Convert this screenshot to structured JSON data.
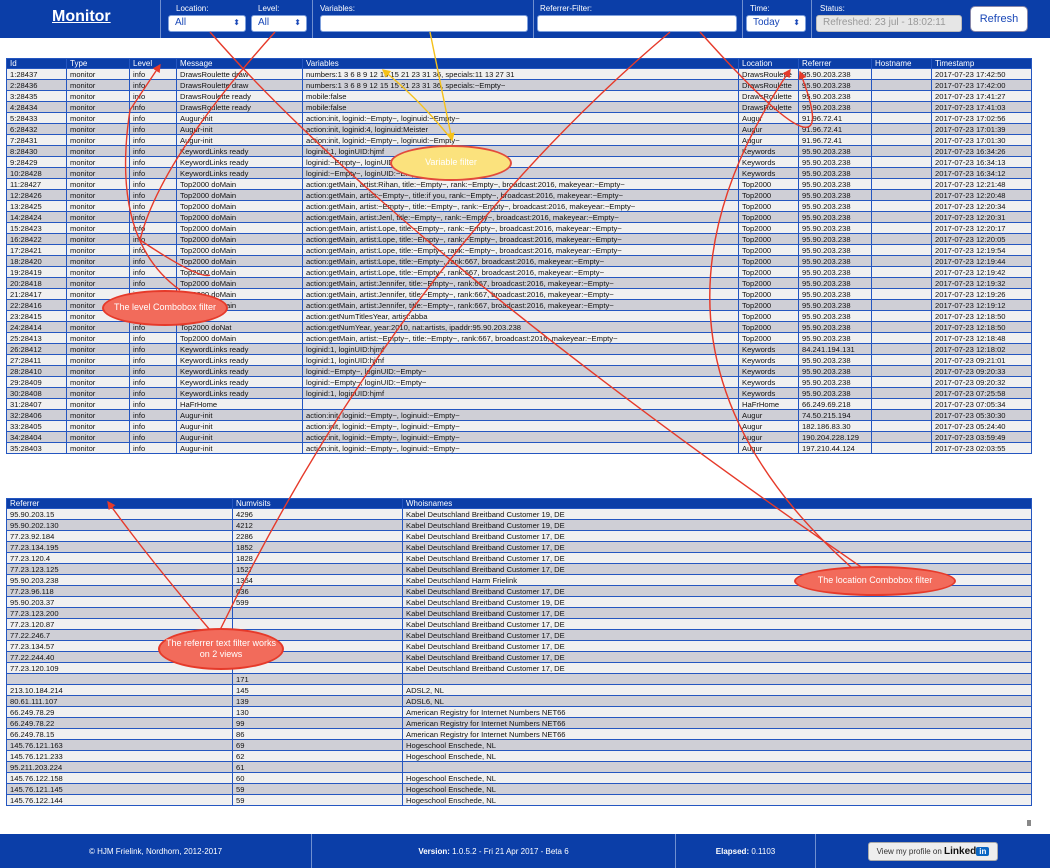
{
  "header": {
    "logo": "Monitor",
    "location": {
      "label": "Location:",
      "value": "All"
    },
    "level": {
      "label": "Level:",
      "value": "All"
    },
    "variables": {
      "label": "Variables:",
      "value": ""
    },
    "referrer_filter": {
      "label": "Referrer-Filter:",
      "value": ""
    },
    "time": {
      "label": "Time:",
      "value": "Today"
    },
    "status": {
      "label": "Status:",
      "value": "Refreshed: 23 jul - 18:02:11"
    },
    "refresh_label": "Refresh"
  },
  "log_table": {
    "columns": [
      "Id",
      "Type",
      "Level",
      "Message",
      "Variables",
      "Location",
      "Referrer",
      "Hostname",
      "Timestamp"
    ],
    "rows": [
      [
        "1:28437",
        "monitor",
        "info",
        "DrawsRoulette draw",
        "numbers:1 3 6 8 9 12 15 15 21 23 31 36, specials:11 13 27 31",
        "DrawsRoulette",
        "95.90.203.238",
        "",
        "2017-07-23 17:42:50"
      ],
      [
        "2:28436",
        "monitor",
        "info",
        "DrawsRoulette draw",
        "numbers:1 3 6 8 9 12 15 15 21 23 31 36, specials:~Empty~",
        "DrawsRoulette",
        "95.90.203.238",
        "",
        "2017-07-23 17:42:00"
      ],
      [
        "3:28435",
        "monitor",
        "info",
        "DrawsRoulette ready",
        "mobile:false",
        "DrawsRoulette",
        "95.90.203.238",
        "",
        "2017-07-23 17:41:27"
      ],
      [
        "4:28434",
        "monitor",
        "info",
        "DrawsRoulette ready",
        "mobile:false",
        "DrawsRoulette",
        "95.90.203.238",
        "",
        "2017-07-23 17:41:03"
      ],
      [
        "5:28433",
        "monitor",
        "info",
        "Augur-init",
        "action:init, loginid:~Empty~, loginuid:~Empty~",
        "Augur",
        "91.96.72.41",
        "",
        "2017-07-23 17:02:56"
      ],
      [
        "6:28432",
        "monitor",
        "info",
        "Augur-init",
        "action:init, loginid:4, loginuid:Meister",
        "Augur",
        "91.96.72.41",
        "",
        "2017-07-23 17:01:39"
      ],
      [
        "7:28431",
        "monitor",
        "info",
        "Augur-init",
        "action:init, loginid:~Empty~, loginuid:~Empty~",
        "Augur",
        "91.96.72.41",
        "",
        "2017-07-23 17:01:30"
      ],
      [
        "8:28430",
        "monitor",
        "info",
        "KeywordLinks ready",
        "loginid:1, loginUID:hjmf",
        "Keywords",
        "95.90.203.238",
        "",
        "2017-07-23 16:34:26"
      ],
      [
        "9:28429",
        "monitor",
        "info",
        "KeywordLinks ready",
        "loginid:~Empty~, loginUID:~Empty~",
        "Keywords",
        "95.90.203.238",
        "",
        "2017-07-23 16:34:13"
      ],
      [
        "10:28428",
        "monitor",
        "info",
        "KeywordLinks ready",
        "loginid:~Empty~, loginUID:~Empty~",
        "Keywords",
        "95.90.203.238",
        "",
        "2017-07-23 16:34:12"
      ],
      [
        "11:28427",
        "monitor",
        "info",
        "Top2000 doMain",
        "action:getMain, artist:Rihan, title:~Empty~, rank:~Empty~, broadcast:2016, makeyear:~Empty~",
        "Top2000",
        "95.90.203.238",
        "",
        "2017-07-23 12:21:48"
      ],
      [
        "12:28426",
        "monitor",
        "info",
        "Top2000 doMain",
        "action:getMain, artist:~Empty~, title:if you, rank:~Empty~, broadcast:2016, makeyear:~Empty~",
        "Top2000",
        "95.90.203.238",
        "",
        "2017-07-23 12:20:48"
      ],
      [
        "13:28425",
        "monitor",
        "info",
        "Top2000 doMain",
        "action:getMain, artist:~Empty~, title:~Empty~, rank:~Empty~, broadcast:2016, makeyear:~Empty~",
        "Top2000",
        "95.90.203.238",
        "",
        "2017-07-23 12:20:34"
      ],
      [
        "14:28424",
        "monitor",
        "info",
        "Top2000 doMain",
        "action:getMain, artist:Jenl, title:~Empty~, rank:~Empty~, broadcast:2016, makeyear:~Empty~",
        "Top2000",
        "95.90.203.238",
        "",
        "2017-07-23 12:20:31"
      ],
      [
        "15:28423",
        "monitor",
        "info",
        "Top2000 doMain",
        "action:getMain, artist:Lope, title:~Empty~, rank:~Empty~, broadcast:2016, makeyear:~Empty~",
        "Top2000",
        "95.90.203.238",
        "",
        "2017-07-23 12:20:17"
      ],
      [
        "16:28422",
        "monitor",
        "info",
        "Top2000 doMain",
        "action:getMain, artist:Lope, title:~Empty~, rank:~Empty~, broadcast:2016, makeyear:~Empty~",
        "Top2000",
        "95.90.203.238",
        "",
        "2017-07-23 12:20:05"
      ],
      [
        "17:28421",
        "monitor",
        "info",
        "Top2000 doMain",
        "action:getMain, artist:Lope, title:~Empty~, rank:~Empty~, broadcast:2016, makeyear:~Empty~",
        "Top2000",
        "95.90.203.238",
        "",
        "2017-07-23 12:19:54"
      ],
      [
        "18:28420",
        "monitor",
        "info",
        "Top2000 doMain",
        "action:getMain, artist:Lope, title:~Empty~, rank:667, broadcast:2016, makeyear:~Empty~",
        "Top2000",
        "95.90.203.238",
        "",
        "2017-07-23 12:19:44"
      ],
      [
        "19:28419",
        "monitor",
        "info",
        "Top2000 doMain",
        "action:getMain, artist:Lope, title:~Empty~, rank:667, broadcast:2016, makeyear:~Empty~",
        "Top2000",
        "95.90.203.238",
        "",
        "2017-07-23 12:19:42"
      ],
      [
        "20:28418",
        "monitor",
        "info",
        "Top2000 doMain",
        "action:getMain, artist:Jennifer, title:~Empty~, rank:667, broadcast:2016, makeyear:~Empty~",
        "Top2000",
        "95.90.203.238",
        "",
        "2017-07-23 12:19:32"
      ],
      [
        "21:28417",
        "monitor",
        "info",
        "Top2000 doMain",
        "action:getMain, artist:Jennifer, title:~Empty~, rank:667, broadcast:2016, makeyear:~Empty~",
        "Top2000",
        "95.90.203.238",
        "",
        "2017-07-23 12:19:26"
      ],
      [
        "22:28416",
        "monitor",
        "info",
        "Top2000 doMain",
        "action:getMain, artist:Jennifer, title:~Empty~, rank:667, broadcast:2016, makeyear:~Empty~",
        "Top2000",
        "95.90.203.238",
        "",
        "2017-07-23 12:19:12"
      ],
      [
        "23:28415",
        "monitor",
        "info",
        "",
        "action:getNumTitlesYear, artist:abba",
        "Top2000",
        "95.90.203.238",
        "",
        "2017-07-23 12:18:50"
      ],
      [
        "24:28414",
        "monitor",
        "info",
        "Top2000 doNat",
        "action:getNumYear, year:2010, nat:artists, ipaddr:95.90.203.238",
        "Top2000",
        "95.90.203.238",
        "",
        "2017-07-23 12:18:50"
      ],
      [
        "25:28413",
        "monitor",
        "info",
        "Top2000 doMain",
        "action:getMain, artist:~Empty~, title:~Empty~, rank:667, broadcast:2016, makeyear:~Empty~",
        "Top2000",
        "95.90.203.238",
        "",
        "2017-07-23 12:18:48"
      ],
      [
        "26:28412",
        "monitor",
        "info",
        "KeywordLinks ready",
        "loginid:1, loginUID:hjmf",
        "Keywords",
        "84.241.194.131",
        "",
        "2017-07-23 12:18:02"
      ],
      [
        "27:28411",
        "monitor",
        "info",
        "KeywordLinks ready",
        "loginid:1, loginUID:hjmf",
        "Keywords",
        "95.90.203.238",
        "",
        "2017-07-23 09:21:01"
      ],
      [
        "28:28410",
        "monitor",
        "info",
        "KeywordLinks ready",
        "loginid:~Empty~, loginUID:~Empty~",
        "Keywords",
        "95.90.203.238",
        "",
        "2017-07-23 09:20:33"
      ],
      [
        "29:28409",
        "monitor",
        "info",
        "KeywordLinks ready",
        "loginid:~Empty~, loginUID:~Empty~",
        "Keywords",
        "95.90.203.238",
        "",
        "2017-07-23 09:20:32"
      ],
      [
        "30:28408",
        "monitor",
        "info",
        "KeywordLinks ready",
        "loginid:1, loginUID:hjmf",
        "Keywords",
        "95.90.203.238",
        "",
        "2017-07-23 07:25:58"
      ],
      [
        "31:28407",
        "monitor",
        "info",
        "HaFrHome",
        "",
        "HaFrHome",
        "66.249.69.218",
        "",
        "2017-07-23 07:05:34"
      ],
      [
        "32:28406",
        "monitor",
        "info",
        "Augur-init",
        "action:init, loginid:~Empty~, loginuid:~Empty~",
        "Augur",
        "74.50.215.194",
        "",
        "2017-07-23 05:30:30"
      ],
      [
        "33:28405",
        "monitor",
        "info",
        "Augur-init",
        "action:init, loginid:~Empty~, loginuid:~Empty~",
        "Augur",
        "182.186.83.30",
        "",
        "2017-07-23 05:24:40"
      ],
      [
        "34:28404",
        "monitor",
        "info",
        "Augur-init",
        "action:init, loginid:~Empty~, loginuid:~Empty~",
        "Augur",
        "190.204.228.129",
        "",
        "2017-07-23 03:59:49"
      ],
      [
        "35:28403",
        "monitor",
        "info",
        "Augur-init",
        "action:init, loginid:~Empty~, loginuid:~Empty~",
        "Augur",
        "197.210.44.124",
        "",
        "2017-07-23 02:03:55"
      ]
    ]
  },
  "ref_table": {
    "columns": [
      "Referrer",
      "Numvisits",
      "Whoisnames"
    ],
    "rows": [
      [
        "95.90.203.15",
        "4296",
        "Kabel Deutschland Breitband Customer 19, DE"
      ],
      [
        "95.90.202.130",
        "4212",
        "Kabel Deutschland Breitband Customer 19, DE"
      ],
      [
        "77.23.92.184",
        "2286",
        "Kabel Deutschland Breitband Customer 17, DE"
      ],
      [
        "77.23.134.195",
        "1852",
        "Kabel Deutschland Breitband Customer 17, DE"
      ],
      [
        "77.23.120.4",
        "1828",
        "Kabel Deutschland Breitband Customer 17, DE"
      ],
      [
        "77.23.123.125",
        "1527",
        "Kabel Deutschland Breitband Customer 17, DE"
      ],
      [
        "95.90.203.238",
        "1354",
        "Kabel Deutschland Harm Frielink"
      ],
      [
        "77.23.96.118",
        "636",
        "Kabel Deutschland Breitband Customer 17, DE"
      ],
      [
        "95.90.203.37",
        "599",
        "Kabel Deutschland Breitband Customer 19, DE"
      ],
      [
        "77.23.123.200",
        "",
        "Kabel Deutschland Breitband Customer 17, DE"
      ],
      [
        "77.23.120.87",
        "",
        "Kabel Deutschland Breitband Customer 17, DE"
      ],
      [
        "77.22.246.7",
        "",
        "Kabel Deutschland Breitband Customer 17, DE"
      ],
      [
        "77.23.134.57",
        "",
        "Kabel Deutschland Breitband Customer 17, DE"
      ],
      [
        "77.22.244.40",
        "",
        "Kabel Deutschland Breitband Customer 17, DE"
      ],
      [
        "77.23.120.109",
        "",
        "Kabel Deutschland Breitband Customer 17, DE"
      ],
      [
        "",
        "171",
        ""
      ],
      [
        "213.10.184.214",
        "145",
        "ADSL2, NL"
      ],
      [
        "80.61.111.107",
        "139",
        "ADSL6, NL"
      ],
      [
        "66.249.78.29",
        "130",
        "American Registry for Internet Numbers NET66"
      ],
      [
        "66.249.78.22",
        "99",
        "American Registry for Internet Numbers NET66"
      ],
      [
        "66.249.78.15",
        "86",
        "American Registry for Internet Numbers NET66"
      ],
      [
        "145.76.121.163",
        "69",
        "Hogeschool Enschede, NL"
      ],
      [
        "145.76.121.233",
        "62",
        "Hogeschool Enschede, NL"
      ],
      [
        "95.211.203.224",
        "61",
        ""
      ],
      [
        "145.76.122.158",
        "60",
        "Hogeschool Enschede, NL"
      ],
      [
        "145.76.121.145",
        "59",
        "Hogeschool Enschede, NL"
      ],
      [
        "145.76.122.144",
        "59",
        "Hogeschool Enschede, NL"
      ]
    ]
  },
  "callouts": {
    "variable": "Variable filter",
    "level": "The level Combobox filter",
    "referrer": "The referrer text filter works on 2 views",
    "location": "The location Combobox filter"
  },
  "footer": {
    "copyright": "© HJM Frielink, Nordhorn, 2012-2017",
    "version_label": "Version:",
    "version_value": "1.0.5.2 - Fri 21 Apr 2017 - Beta 6",
    "elapsed_label": "Elapsed:",
    "elapsed_value": "0.1103",
    "linkedin_prefix": "View my profile on",
    "linkedin_brand": "Linked",
    "linkedin_in": "in"
  },
  "colors": {
    "header": "#0b3ea8",
    "row_alt": "#cfcfd6",
    "callout_yellow": "#fbe27d",
    "callout_red": "#f26b5b",
    "arrow_red": "#e63a2a",
    "arrow_yellow": "#f5c11a"
  }
}
